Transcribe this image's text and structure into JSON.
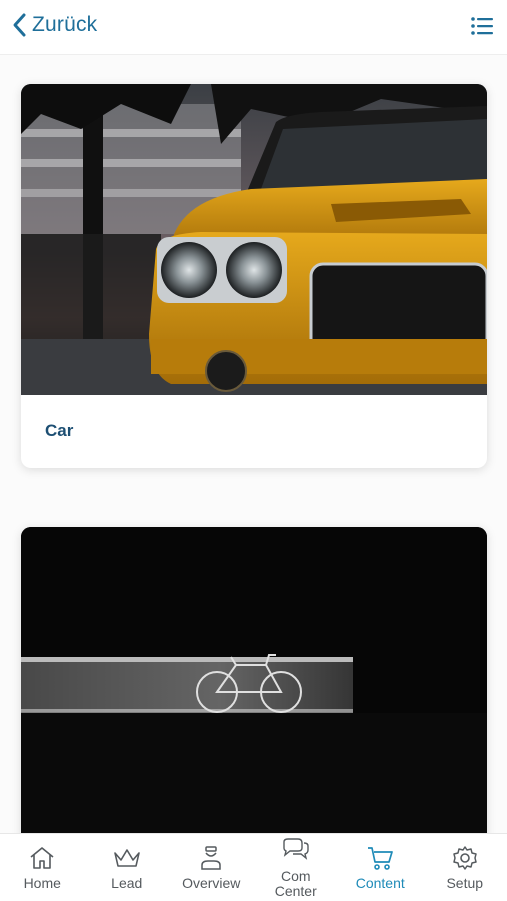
{
  "header": {
    "back_label": "Zurück"
  },
  "cards": [
    {
      "title": "Car",
      "image_name": "yellow-classic-car-photo"
    },
    {
      "title": "",
      "image_name": "bicycle-dark-photo"
    }
  ],
  "nav": {
    "items": [
      {
        "label": "Home",
        "icon": "home-icon"
      },
      {
        "label": "Lead",
        "icon": "crown-icon"
      },
      {
        "label": "Overview",
        "icon": "person-icon"
      },
      {
        "label": "Com Center",
        "line1": "Com",
        "line2": "Center",
        "icon": "chat-icon"
      },
      {
        "label": "Content",
        "icon": "cart-icon",
        "active": true
      },
      {
        "label": "Setup",
        "icon": "gear-icon"
      }
    ]
  },
  "colors": {
    "accent": "#1f8bb8",
    "title": "#1d4f73",
    "nav_text": "#555a5e"
  }
}
